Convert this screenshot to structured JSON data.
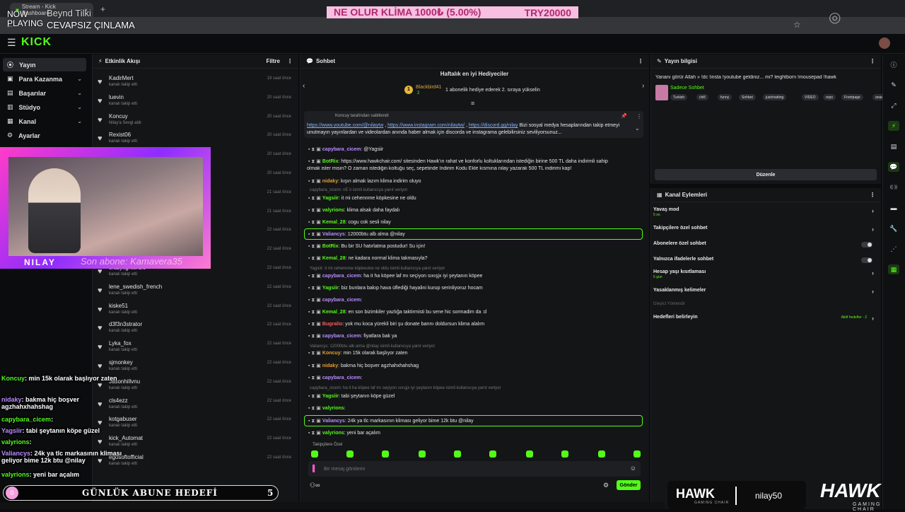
{
  "browser": {
    "tab_title": "Stream - Kick Dashboard",
    "new_tab": "+"
  },
  "overlay_top": {
    "now_playing": "NOW PLAYING",
    "artist": "Beynd Tilki",
    "song": "CEVAPSIZ ÇINLAMA",
    "goal_text": "NE OLUR KLİMA 1000₺ (5.00%)",
    "goal_amount": "TRY20000"
  },
  "app": {
    "logo": "KICK"
  },
  "sidebar": {
    "items": [
      {
        "label": "Yayın",
        "icon": "⦿"
      },
      {
        "label": "Para Kazanma",
        "icon": "▣"
      },
      {
        "label": "Başarılar",
        "icon": "▤"
      },
      {
        "label": "Stüdyo",
        "icon": "▥"
      },
      {
        "label": "Kanal",
        "icon": "▦"
      },
      {
        "label": "Ayarlar",
        "icon": "⚙"
      }
    ]
  },
  "feed": {
    "title": "Etkinlik Akışı",
    "filter": "Filtre",
    "rows": [
      {
        "name": "KadirMert",
        "sub": "kanalı takip etti",
        "time": "19 saat önce"
      },
      {
        "name": "luevin",
        "sub": "kanalı takip etti",
        "time": "20 saat önce"
      },
      {
        "name": "Koncuy",
        "sub": "Nilay'a Sevgi aldı",
        "time": "20 saat önce"
      },
      {
        "name": "Rexist06",
        "sub": "kanalı takip etti",
        "time": "20 saat önce"
      },
      {
        "name": "",
        "sub": "",
        "time": "20 saat önce"
      },
      {
        "name": "",
        "sub": "",
        "time": "20 saat önce"
      },
      {
        "name": "",
        "sub": "",
        "time": "21 saat önce"
      },
      {
        "name": "",
        "sub": "",
        "time": "21 saat önce"
      },
      {
        "name": "",
        "sub": "",
        "time": "22 saat önce"
      },
      {
        "name": "",
        "sub": "",
        "time": "22 saat önce"
      },
      {
        "name": "crazyfighterufc",
        "sub": "kanalı takip etti",
        "time": "22 saat önce"
      },
      {
        "name": "lene_swedish_french",
        "sub": "kanalı takip etti",
        "time": "22 saat önce"
      },
      {
        "name": "kiske51",
        "sub": "kanalı takip etti",
        "time": "22 saat önce"
      },
      {
        "name": "d3f3n3strator",
        "sub": "kanalı takip etti",
        "time": "22 saat önce"
      },
      {
        "name": "Lyka_fox",
        "sub": "kanalı takip etti",
        "time": "22 saat önce"
      },
      {
        "name": "sjmonkey",
        "sub": "kanalı takip etti",
        "time": "22 saat önce"
      },
      {
        "name": "Jasonhillvnu",
        "sub": "kanalı takip etti",
        "time": "22 saat önce"
      },
      {
        "name": "cls4ezz",
        "sub": "kanalı takip etti",
        "time": "22 saat önce"
      },
      {
        "name": "kotgabuser",
        "sub": "kanalı takip etti",
        "time": "22 saat önce"
      },
      {
        "name": "kick_Automat",
        "sub": "kanalı takip etti",
        "time": "22 saat önce"
      },
      {
        "name": "egosoftofficial",
        "sub": "kanalı takip etti",
        "time": "22 saat önce"
      }
    ]
  },
  "webcam": {
    "name": "NILAY",
    "latest_sub": "Son abone: Kamavera35"
  },
  "chat_overlay": [
    {
      "user": "Koncuy",
      "text": ": min 15k olarak başlıyor zaten"
    },
    {
      "user": "nidaky",
      "text": ": bakma hiç boşver agzhahxhahshag"
    },
    {
      "user": "capybara_cicem",
      "text": ":"
    },
    {
      "user": "Yagsiir",
      "text": ": tabi şeytanın köpe güzel"
    },
    {
      "user": "valyrions",
      "text": ":"
    },
    {
      "user": "Valiancys",
      "text": ": 24k ya tlc markasının kliması geliyor bime 12k btu @nilay"
    },
    {
      "user": "valyrions",
      "text": ": yeni bar açalım"
    }
  ],
  "sub_goal": {
    "count": "0",
    "label": "GÜNLÜK ABUNE HEDEFİ",
    "target": "5"
  },
  "chat": {
    "title": "Sohbet",
    "gifters_title": "Haftalık en iyi Hediyeciler",
    "top_gifter": "Blackbird41",
    "top_gifter_rank": "1",
    "top_gifter_count": "2",
    "gifter_msg": "1 abonelik hediye ederek 2. sıraya yükselin",
    "pinned_by": "Koncuy tarafından sabitlendi",
    "pinned_text": "https://www.youtube.com/@nilaytw , https://www.instagram.com/nilaytw/ , https://discord.gg/nilay Bizi sosyal medya hesaplarından takip etmeyi unutmayın yayınlardan ve videolardan anında haber almak için discorda ve instagrama gelebilirsiniz seviliyorsunuz...",
    "messages": [
      {
        "user": "capybara_cicem",
        "text": ": @Yagsiir",
        "color": "#b98cff"
      },
      {
        "user": "BotRix",
        "text": ": https://www.hawkchair.com/ sitesinden Hawk'ın rahat ve konforlu koltuklarından istediğin birine 500 TL daha indirimli sahip",
        "color": "#53fc18"
      },
      {
        "user": "",
        "text": "olmak ister misin? O zaman istediğin koltuğu seç, sepetinde İndirim Kodu Ekle kısmına nilay yazarak 500 TL indirimi kap!",
        "color": "#e6e6e6"
      },
      {
        "user": "nidaky",
        "text": ": kışın almak lazım klima indirim oluyo",
        "color": "#e0a030"
      },
      {
        "user": "Yagsiir",
        "text": ": it mi cehennme köpkesine ne oldu",
        "color": "#53fc18"
      },
      {
        "user": "valyrions",
        "text": ": klima alsak daha faydalı",
        "color": "#53fc18"
      },
      {
        "user": "Kemal_28",
        "text": ": cogu cok sesli nilay",
        "color": "#53fc18"
      },
      {
        "user": "Valiancys",
        "text": ": 12000btu alb alma @nilay",
        "color": "#b98cff"
      },
      {
        "user": "BotRix",
        "text": ": Bu bir SU hatırlatma postudur! Su için!",
        "color": "#53fc18"
      },
      {
        "user": "Kemal_28",
        "text": ": ne kadara normal klima takmasıyla?",
        "color": "#53fc18"
      },
      {
        "user": "capybara_cicem",
        "text": ": ha it ha köpee laf mı seçiyon sıxışjx iyi şeytanın köpee",
        "color": "#b98cff"
      },
      {
        "user": "Yagsiir",
        "text": ": biz bunlara bakıp hava üflediği hayalini kurup serinliyoruz hocam",
        "color": "#53fc18"
      },
      {
        "user": "capybara_cicem",
        "text": ":",
        "color": "#b98cff"
      },
      {
        "user": "Kemal_28",
        "text": ": en son bizimkiler yazlığa taktirmisti bu sene hic sormadim da :d",
        "color": "#53fc18"
      },
      {
        "user": "Bugralio",
        "text": ": yok mu koca yürekli biri şu donate barını doldursun klima alalım",
        "color": "#ff5a5a"
      },
      {
        "user": "capybara_cicem",
        "text": ": fiyatlara bak ya",
        "color": "#b98cff"
      },
      {
        "user": "Koncuy",
        "text": ": min 15k olarak başlıyor zaten",
        "color": "#e0a030"
      },
      {
        "user": "nidaky",
        "text": ": bakma hiç boşver agzhahxhahshag",
        "color": "#e0a030"
      },
      {
        "user": "capybara_cicem",
        "text": ":",
        "color": "#b98cff"
      },
      {
        "user": "Yagsiir",
        "text": ": tabi şeytanın köpe güzel",
        "color": "#53fc18"
      },
      {
        "user": "valyrions",
        "text": ":",
        "color": "#53fc18"
      },
      {
        "user": "Valiancys",
        "text": ": 24k ya tlc markasının kliması geliyor bime 12k btu @nilay",
        "color": "#b98cff"
      },
      {
        "user": "valyrions",
        "text": ": yeni bar açalım",
        "color": "#53fc18"
      }
    ],
    "replies": [
      "capybara_cicem: nE it isimli kullanıcıya yanıt veriyor",
      "Yagsiir: it mi cehennme köpkesine ne oldu isimli kullanıcıya yanıt veriyor",
      "Valiancys: 12000btu alb alma @nilay isimli kullanıcıya yanıt veriyor",
      "capybara_cicem: ha it ha köpee laf mı seçiyon sıxışjx iyi şeytanın köpee isimli kullanıcıya yanıt veriyor"
    ],
    "follower_only": "Takipçilere Özel",
    "input_placeholder": "Bir mesaj gönderin",
    "send_label": "Gönder"
  },
  "info": {
    "title": "Yayın bilgisi",
    "stream_title": "Yananı görür Allah » !dc !insta !youtube geldiniz... mi? leightborn !mousepad !hawk",
    "category": "Sadece Sohbet",
    "tags": [
      "Turkish",
      "chill",
      "funny",
      "Sohbet",
      "justchatting",
      "VIDEO",
      "repo",
      "Frontpage",
      "anasayfa"
    ],
    "edit_label": "Düzenle"
  },
  "actions": {
    "title": "Kanal Eylemleri",
    "items": [
      {
        "label": "Yavaş mod",
        "sub": "5 sn.",
        "kind": "chevron"
      },
      {
        "label": "Takipçilere özel sohbet",
        "sub": "",
        "kind": "chevron"
      },
      {
        "label": "Abonelere özel sohbet",
        "sub": "",
        "kind": "toggle"
      },
      {
        "label": "Yalnızca ifadelerle sohbet",
        "sub": "",
        "kind": "toggle"
      },
      {
        "label": "Hesap yaşı kısıtlaması",
        "sub": "5 gün",
        "kind": "chevron"
      },
      {
        "label": "Yasaklanmış kelimeler",
        "sub": "",
        "kind": "chevron"
      }
    ],
    "host_label": "İzleyici Yönlendir",
    "goals_label": "Hedefleri belirleyin",
    "goals_status": "Aktif hedefler - 2"
  },
  "sponsor": {
    "brand": "HAWK",
    "brand_sub": "GAMING CHAIR",
    "code": "nilay50"
  },
  "colors": {
    "accent": "#53fc18",
    "panel": "#141517",
    "bg": "#0b0c0e"
  }
}
